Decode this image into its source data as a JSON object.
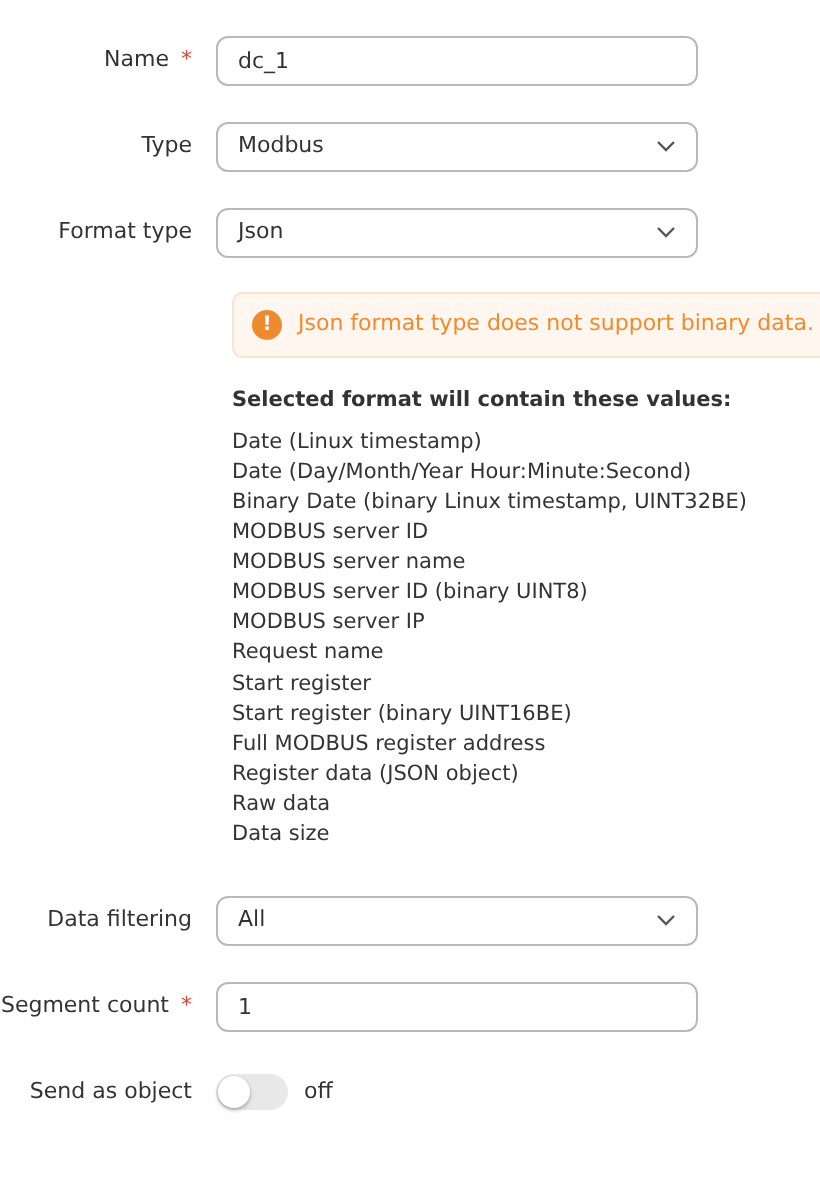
{
  "fields_top": [
    {
      "kind": "text",
      "label": "Name",
      "required_mark": "*",
      "value": "dc_1"
    },
    {
      "kind": "select",
      "label": "Type",
      "value": "Modbus"
    },
    {
      "kind": "select",
      "label": "Format type",
      "value": "Json"
    }
  ],
  "alert": {
    "icon": "!",
    "text": "Json format type does not support binary data."
  },
  "values_heading": "Selected format will contain these values:",
  "values": [
    "Date (Linux timestamp)",
    "Date (Day/Month/Year Hour:Minute:Second)",
    "Binary Date (binary Linux timestamp, UINT32BE)",
    "MODBUS server ID",
    "MODBUS server name",
    "MODBUS server ID (binary UINT8)",
    "MODBUS server IP",
    "Request name",
    "Start register",
    "Start register (binary UINT16BE)",
    "Full MODBUS register address",
    "Register data (JSON object)",
    "Raw data",
    "Data size"
  ],
  "fields_bottom": [
    {
      "kind": "select",
      "label": "Data filtering",
      "value": "All"
    },
    {
      "kind": "text",
      "label": "Segment count",
      "required_mark": "*",
      "value": "1"
    },
    {
      "kind": "toggle",
      "label": "Send as object",
      "on": false,
      "state_text": "off"
    }
  ]
}
